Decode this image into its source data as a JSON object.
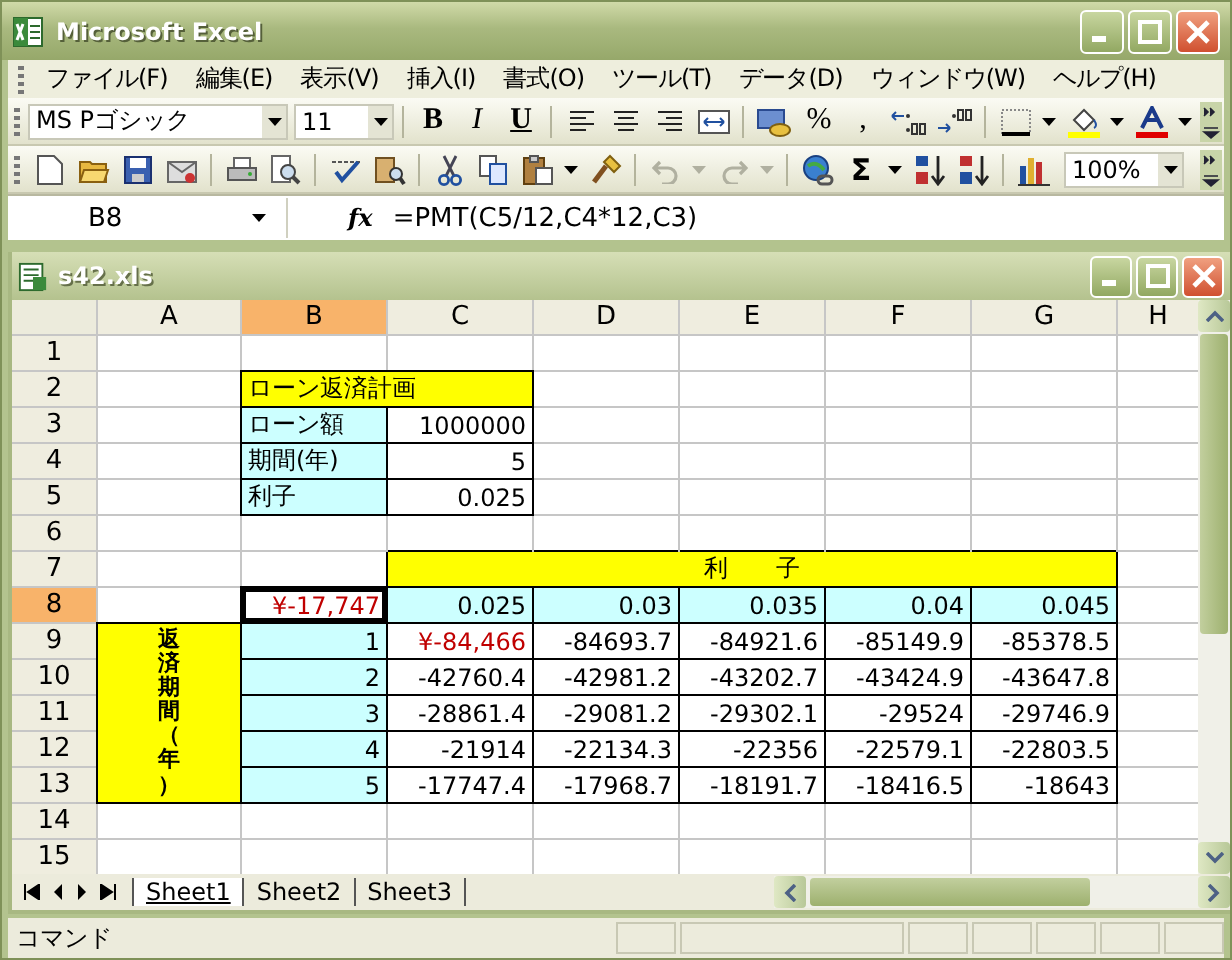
{
  "window": {
    "title": "Microsoft Excel"
  },
  "menu": [
    "ファイル(F)",
    "編集(E)",
    "表示(V)",
    "挿入(I)",
    "書式(O)",
    "ツール(T)",
    "データ(D)",
    "ウィンドウ(W)",
    "ヘルプ(H)"
  ],
  "formatting_toolbar": {
    "font": "MS Pゴシック",
    "size": "11",
    "bold": "B",
    "italic": "I",
    "underline": "U",
    "percent": "%",
    "comma": ","
  },
  "standard_toolbar": {
    "undo_disabled": true,
    "redo_disabled": true,
    "autosum": "Σ",
    "zoom": "100%"
  },
  "formula_bar": {
    "name_box": "B8",
    "fx": "fx",
    "formula": "=PMT(C5/12,C4*12,C3)"
  },
  "workbook": {
    "title": "s42.xls",
    "columns": [
      {
        "label": "A",
        "selected": false
      },
      {
        "label": "B",
        "selected": true
      },
      {
        "label": "C",
        "selected": false
      },
      {
        "label": "D",
        "selected": false
      },
      {
        "label": "E",
        "selected": false
      },
      {
        "label": "F",
        "selected": false
      },
      {
        "label": "G",
        "selected": false
      },
      {
        "label": "H",
        "selected": false
      }
    ],
    "rows": [
      {
        "label": "1",
        "selected": false,
        "cells": [
          {
            "kind": "empty",
            "selected": false
          },
          {
            "kind": "empty",
            "selected": false
          },
          {
            "kind": "empty",
            "selected": false
          },
          {
            "kind": "empty",
            "selected": false
          },
          {
            "kind": "empty",
            "selected": false
          },
          {
            "kind": "empty",
            "selected": false
          },
          {
            "kind": "empty",
            "selected": false
          },
          {
            "kind": "empty",
            "selected": false
          }
        ]
      },
      {
        "label": "2",
        "selected": false,
        "cells": [
          {
            "kind": "empty",
            "selected": false
          },
          {
            "kind": "title",
            "text": "ローン返済計画",
            "selected": false
          },
          {
            "kind": "covered"
          },
          {
            "kind": "empty",
            "selected": false
          },
          {
            "kind": "empty",
            "selected": false
          },
          {
            "kind": "empty",
            "selected": false
          },
          {
            "kind": "empty",
            "selected": false
          },
          {
            "kind": "empty",
            "selected": false
          }
        ]
      },
      {
        "label": "3",
        "selected": false,
        "cells": [
          {
            "kind": "empty",
            "selected": false
          },
          {
            "kind": "label",
            "text": "ローン額",
            "selected": false
          },
          {
            "kind": "number",
            "text": "1000000",
            "selected": false
          },
          {
            "kind": "empty",
            "selected": false
          },
          {
            "kind": "empty",
            "selected": false
          },
          {
            "kind": "empty",
            "selected": false
          },
          {
            "kind": "empty",
            "selected": false
          },
          {
            "kind": "empty",
            "selected": false
          }
        ]
      },
      {
        "label": "4",
        "selected": false,
        "cells": [
          {
            "kind": "empty",
            "selected": false
          },
          {
            "kind": "label",
            "text": "期間(年)",
            "selected": false
          },
          {
            "kind": "number",
            "text": "5",
            "selected": false
          },
          {
            "kind": "empty",
            "selected": false
          },
          {
            "kind": "empty",
            "selected": false
          },
          {
            "kind": "empty",
            "selected": false
          },
          {
            "kind": "empty",
            "selected": false
          },
          {
            "kind": "empty",
            "selected": false
          }
        ]
      },
      {
        "label": "5",
        "selected": false,
        "cells": [
          {
            "kind": "empty",
            "selected": false
          },
          {
            "kind": "label",
            "text": "利子",
            "selected": false
          },
          {
            "kind": "number",
            "text": "0.025",
            "selected": false
          },
          {
            "kind": "empty",
            "selected": false
          },
          {
            "kind": "empty",
            "selected": false
          },
          {
            "kind": "empty",
            "selected": false
          },
          {
            "kind": "empty",
            "selected": false
          },
          {
            "kind": "empty",
            "selected": false
          }
        ]
      },
      {
        "label": "6",
        "selected": false,
        "cells": [
          {
            "kind": "empty",
            "selected": false
          },
          {
            "kind": "empty",
            "selected": false
          },
          {
            "kind": "empty",
            "selected": false
          },
          {
            "kind": "empty",
            "selected": false
          },
          {
            "kind": "empty",
            "selected": false
          },
          {
            "kind": "empty",
            "selected": false
          },
          {
            "kind": "empty",
            "selected": false
          },
          {
            "kind": "empty",
            "selected": false
          }
        ]
      },
      {
        "label": "7",
        "selected": false,
        "cells": [
          {
            "kind": "empty",
            "selected": false
          },
          {
            "kind": "empty",
            "selected": false
          },
          {
            "kind": "band",
            "selected": false
          },
          {
            "kind": "band",
            "selected": false
          },
          {
            "kind": "band",
            "text": "利　　子",
            "selected": false
          },
          {
            "kind": "band",
            "selected": false
          },
          {
            "kind": "band",
            "selected": false
          },
          {
            "kind": "empty",
            "selected": false
          }
        ]
      },
      {
        "label": "8",
        "selected": true,
        "cells": [
          {
            "kind": "empty",
            "selected": false
          },
          {
            "kind": "currency",
            "text": "¥-17,747",
            "selected": true
          },
          {
            "kind": "rate",
            "text": "0.025",
            "selected": false
          },
          {
            "kind": "rate",
            "text": "0.03",
            "selected": false
          },
          {
            "kind": "rate",
            "text": "0.035",
            "selected": false
          },
          {
            "kind": "rate",
            "text": "0.04",
            "selected": false
          },
          {
            "kind": "rate",
            "text": "0.045",
            "selected": false
          },
          {
            "kind": "empty",
            "selected": false
          }
        ]
      },
      {
        "label": "9",
        "selected": false,
        "cells": [
          {
            "kind": "side",
            "text": "返済期間（年）",
            "selected": false
          },
          {
            "kind": "year",
            "text": "1",
            "selected": false
          },
          {
            "kind": "currency",
            "text": "¥-84,466",
            "selected": false
          },
          {
            "kind": "result",
            "text": "-84693.7",
            "selected": false
          },
          {
            "kind": "result",
            "text": "-84921.6",
            "selected": false
          },
          {
            "kind": "result",
            "text": "-85149.9",
            "selected": false
          },
          {
            "kind": "result",
            "text": "-85378.5",
            "selected": false
          },
          {
            "kind": "empty",
            "selected": false
          }
        ]
      },
      {
        "label": "10",
        "selected": false,
        "cells": [
          {
            "kind": "covered"
          },
          {
            "kind": "year",
            "text": "2",
            "selected": false
          },
          {
            "kind": "result",
            "text": "-42760.4",
            "selected": false
          },
          {
            "kind": "result",
            "text": "-42981.2",
            "selected": false
          },
          {
            "kind": "result",
            "text": "-43202.7",
            "selected": false
          },
          {
            "kind": "result",
            "text": "-43424.9",
            "selected": false
          },
          {
            "kind": "result",
            "text": "-43647.8",
            "selected": false
          },
          {
            "kind": "empty",
            "selected": false
          }
        ]
      },
      {
        "label": "11",
        "selected": false,
        "cells": [
          {
            "kind": "covered"
          },
          {
            "kind": "year",
            "text": "3",
            "selected": false
          },
          {
            "kind": "result",
            "text": "-28861.4",
            "selected": false
          },
          {
            "kind": "result",
            "text": "-29081.2",
            "selected": false
          },
          {
            "kind": "result",
            "text": "-29302.1",
            "selected": false
          },
          {
            "kind": "result",
            "text": "-29524",
            "selected": false
          },
          {
            "kind": "result",
            "text": "-29746.9",
            "selected": false
          },
          {
            "kind": "empty",
            "selected": false
          }
        ]
      },
      {
        "label": "12",
        "selected": false,
        "cells": [
          {
            "kind": "covered"
          },
          {
            "kind": "year",
            "text": "4",
            "selected": false
          },
          {
            "kind": "result",
            "text": "-21914",
            "selected": false
          },
          {
            "kind": "result",
            "text": "-22134.3",
            "selected": false
          },
          {
            "kind": "result",
            "text": "-22356",
            "selected": false
          },
          {
            "kind": "result",
            "text": "-22579.1",
            "selected": false
          },
          {
            "kind": "result",
            "text": "-22803.5",
            "selected": false
          },
          {
            "kind": "empty",
            "selected": false
          }
        ]
      },
      {
        "label": "13",
        "selected": false,
        "cells": [
          {
            "kind": "covered"
          },
          {
            "kind": "year",
            "text": "5",
            "selected": false
          },
          {
            "kind": "result",
            "text": "-17747.4",
            "selected": false
          },
          {
            "kind": "result",
            "text": "-17968.7",
            "selected": false
          },
          {
            "kind": "result",
            "text": "-18191.7",
            "selected": false
          },
          {
            "kind": "result",
            "text": "-18416.5",
            "selected": false
          },
          {
            "kind": "result",
            "text": "-18643",
            "selected": false
          },
          {
            "kind": "empty",
            "selected": false
          }
        ]
      },
      {
        "label": "14",
        "selected": false,
        "cells": [
          {
            "kind": "empty",
            "selected": false
          },
          {
            "kind": "empty",
            "selected": false
          },
          {
            "kind": "empty",
            "selected": false
          },
          {
            "kind": "empty",
            "selected": false
          },
          {
            "kind": "empty",
            "selected": false
          },
          {
            "kind": "empty",
            "selected": false
          },
          {
            "kind": "empty",
            "selected": false
          },
          {
            "kind": "empty",
            "selected": false
          }
        ]
      },
      {
        "label": "15",
        "selected": false,
        "cells": [
          {
            "kind": "empty",
            "selected": false
          },
          {
            "kind": "empty",
            "selected": false
          },
          {
            "kind": "empty",
            "selected": false
          },
          {
            "kind": "empty",
            "selected": false
          },
          {
            "kind": "empty",
            "selected": false
          },
          {
            "kind": "empty",
            "selected": false
          },
          {
            "kind": "empty",
            "selected": false
          },
          {
            "kind": "empty",
            "selected": false
          }
        ]
      }
    ],
    "sheets": [
      {
        "label": "Sheet1",
        "selected": true
      },
      {
        "label": "Sheet2",
        "selected": false
      },
      {
        "label": "Sheet3",
        "selected": false
      }
    ]
  },
  "status_bar": {
    "text": "コマンド"
  }
}
